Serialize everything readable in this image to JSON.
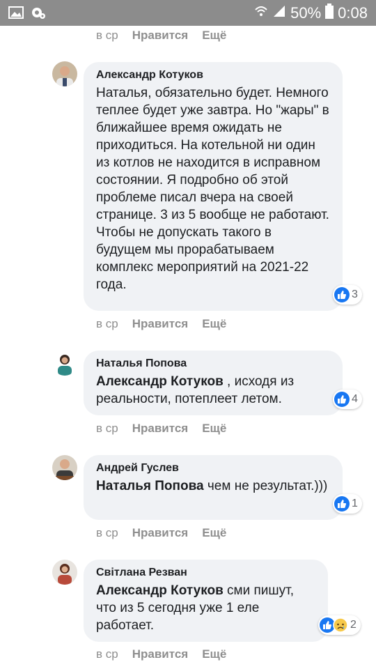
{
  "status_bar": {
    "battery": "50%",
    "time": "0:08",
    "icons": [
      "image-icon",
      "settings-icon",
      "wifi-icon",
      "signal-icon",
      "battery-icon"
    ]
  },
  "top_actions": {
    "time": "в ср",
    "like": "Нравится",
    "more": "Ещё"
  },
  "comments": [
    {
      "author": "Александр Котуков",
      "text": "Наталья, обязательно будет. Немного теплее будет уже завтра. Но \"жары\" в ближайшее время ожидать не приходиться. На котельной ни один из котлов не находится в исправном состоянии. Я подробно об этой проблеме писал вчера на своей странице. 3 из 5 вообще не работают. Чтобы не допускать такого в будущем мы прорабатываем комплекс мероприятий на 2021-22 года.",
      "reactions": "3",
      "time": "в ср",
      "like": "Нравится",
      "more": "Ещё"
    },
    {
      "author": "Наталья Попова",
      "mention": "Александр Котуков",
      "text": " , исходя из реальности, потеплеет летом.",
      "reactions": "4",
      "time": "в ср",
      "like": "Нравится",
      "more": "Ещё"
    },
    {
      "author": "Андрей Гуслев",
      "mention": "Наталья Попова",
      "text": " чем не результат.)))",
      "reactions": "1",
      "time": "в ср",
      "like": "Нравится",
      "more": "Ещё"
    },
    {
      "author": "Світлана Резван",
      "mention": "Александр Котуков",
      "text": " сми пишут, что из 5 сегодня уже 1 еле работает.",
      "reactions": "2",
      "time": "в ср",
      "like": "Нравится",
      "more": "Ещё"
    }
  ],
  "colors": {
    "like_blue": "#1877f2",
    "bubble_bg": "#f0f2f5",
    "meta_gray": "#8e8e8e",
    "status_bar": "#8c8c8c"
  }
}
